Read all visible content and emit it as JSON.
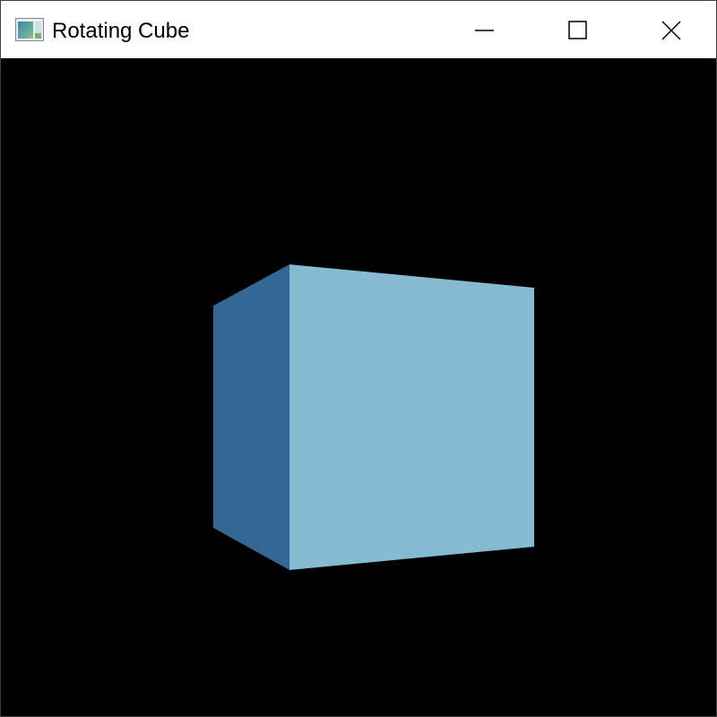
{
  "window": {
    "title": "Rotating Cube",
    "app_icon": "opengl-window-icon",
    "controls": {
      "minimize_icon": "minimize-icon",
      "maximize_icon": "maximize-icon",
      "close_icon": "close-icon"
    }
  },
  "scene": {
    "background_color": "#000000",
    "cube": {
      "front_face_color": "#85bbd1",
      "side_face_color": "#336895"
    }
  }
}
